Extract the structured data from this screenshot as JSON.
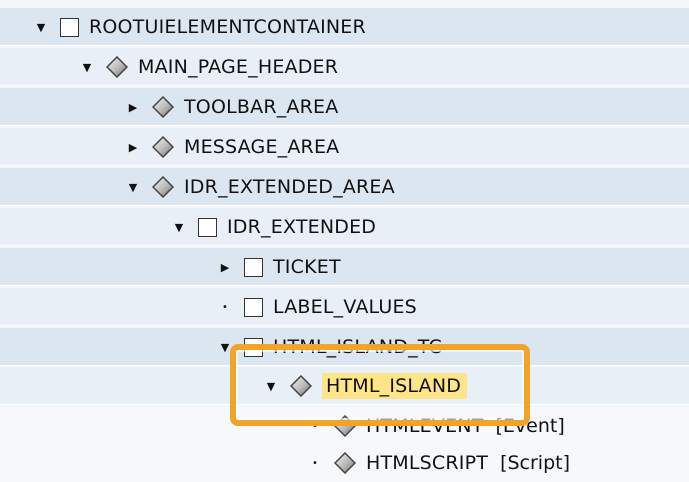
{
  "tree": {
    "rows": [
      {
        "label": "ROOTUIELEMENTCONTAINER",
        "toggle": "expanded",
        "icon": "box-icon"
      },
      {
        "label": "MAIN_PAGE_HEADER",
        "toggle": "expanded",
        "icon": "diamond-icon"
      },
      {
        "label": "TOOLBAR_AREA",
        "toggle": "collapsed",
        "icon": "diamond-icon"
      },
      {
        "label": "MESSAGE_AREA",
        "toggle": "collapsed",
        "icon": "diamond-icon"
      },
      {
        "label": "IDR_EXTENDED_AREA",
        "toggle": "expanded",
        "icon": "diamond-icon"
      },
      {
        "label": "IDR_EXTENDED",
        "toggle": "expanded",
        "icon": "box-icon"
      },
      {
        "label": "TICKET",
        "toggle": "collapsed",
        "icon": "box-icon"
      },
      {
        "label": "LABEL_VALUES",
        "toggle": "leaf",
        "icon": "box-icon"
      },
      {
        "label": "HTML_ISLAND_TC",
        "toggle": "expanded",
        "icon": "box-icon"
      },
      {
        "label": "HTML_ISLAND",
        "toggle": "expanded",
        "icon": "diamond-icon",
        "selected": true
      },
      {
        "label": "HTMLEVENT",
        "suffix": "[Event]",
        "toggle": "leaf",
        "icon": "diamond-icon"
      },
      {
        "label": "HTMLSCRIPT",
        "suffix": "[Script]",
        "toggle": "leaf",
        "icon": "diamond-icon"
      }
    ]
  },
  "colors": {
    "highlight_frame": "#f0a42c",
    "selected_label_bg": "#ffe58a",
    "row_band": "#dce6f0"
  }
}
